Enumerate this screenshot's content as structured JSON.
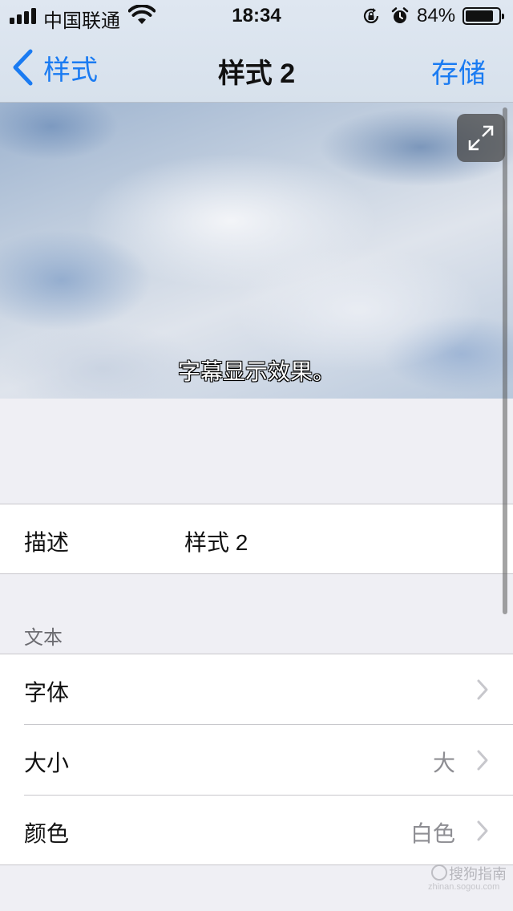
{
  "status_bar": {
    "carrier": "中国联通",
    "time": "18:34",
    "battery_percent": "84%",
    "battery_level": 0.84,
    "icons": [
      "signal-icon",
      "wifi-icon",
      "orientation-lock-icon",
      "alarm-icon",
      "battery-icon"
    ]
  },
  "nav": {
    "back_label": "样式",
    "title": "样式 2",
    "save_label": "存储"
  },
  "preview": {
    "subtitle_text": "字幕显示效果。",
    "expand_icon": "expand-icon"
  },
  "description": {
    "label": "描述",
    "value": "样式 2"
  },
  "text_section": {
    "header": "文本",
    "rows": [
      {
        "label": "字体",
        "value": ""
      },
      {
        "label": "大小",
        "value": "大"
      },
      {
        "label": "颜色",
        "value": "白色"
      }
    ]
  },
  "watermark": {
    "text": "搜狗指南",
    "url": "zhinan.sogou.com"
  },
  "colors": {
    "accent": "#1a7bf2",
    "background": "#efeff4",
    "secondary_text": "#8e8e93"
  }
}
